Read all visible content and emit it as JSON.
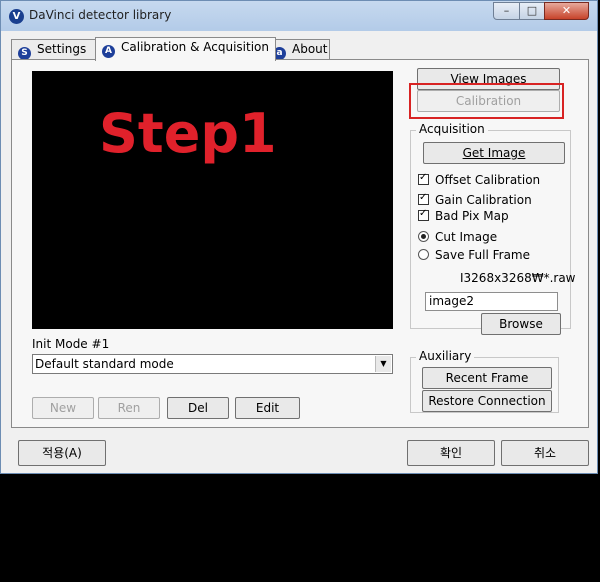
{
  "window": {
    "title": "DaVinci detector library",
    "app_icon": "V",
    "controls": {
      "minimize": "–",
      "maximize": "□",
      "close": "✕"
    }
  },
  "tabs": [
    {
      "label": "Settings",
      "icon": "S",
      "active": false
    },
    {
      "label": "Calibration & Acquisition",
      "icon": "A",
      "active": true
    },
    {
      "label": "About",
      "icon": "a",
      "active": false
    }
  ],
  "overlay": {
    "step_text": "Step1",
    "step_color": "#e0212b",
    "highlight_color": "#d82323"
  },
  "right_panel": {
    "view_images": "View Images",
    "calibration": "Calibration",
    "acquisition": {
      "label": "Acquisition",
      "get_image": "Get Image",
      "offset_calibration": {
        "label": "Offset Calibration",
        "checked": true
      },
      "gain_calibration": {
        "label": "Gain Calibration",
        "checked": true
      },
      "bad_pix_map": {
        "label": "Bad Pix Map",
        "checked": true
      },
      "cut_image": {
        "label": "Cut Image",
        "selected": true
      },
      "save_full_frame": {
        "label": "Save Full Frame",
        "selected": false
      },
      "file_pattern": "I3268x3268₩*.raw",
      "filename_value": "image2",
      "browse": "Browse"
    },
    "auxiliary": {
      "label": "Auxiliary",
      "recent_frame": "Recent Frame",
      "restore_connection": "Restore Connection"
    }
  },
  "init_mode": {
    "label": "Init Mode #1",
    "selected": "Default standard mode",
    "new": "New",
    "ren": "Ren",
    "del": "Del",
    "edit": "Edit"
  },
  "footer": {
    "apply": "적용(A)",
    "ok": "확인",
    "cancel": "취소"
  }
}
